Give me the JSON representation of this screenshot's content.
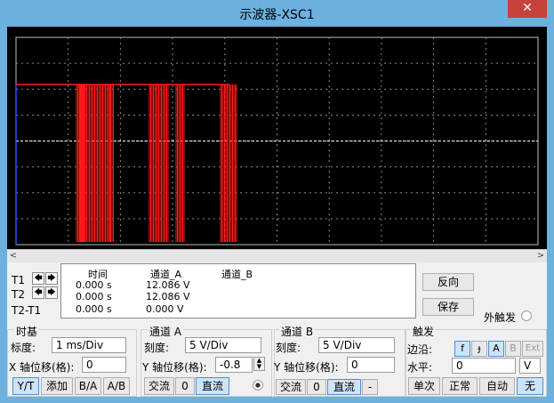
{
  "window": {
    "title": "示波器-XSC1",
    "close_symbol": "✕"
  },
  "screen": {
    "background": "#000000",
    "trace_color": "#ff1a1a",
    "channel_b_color": "#ffffff",
    "grid_color": "#8a8a8a"
  },
  "chart_data": {
    "type": "line",
    "title": "",
    "xlabel": "",
    "ylabel": "",
    "grid": true,
    "divisions_x": 10,
    "divisions_y": 8,
    "series": [
      {
        "name": "通道_A",
        "color": "#ff1a1a",
        "description_values": [
          12.086,
          0.0
        ]
      },
      {
        "name": "通道_B",
        "color": "#ffffff",
        "description_values": [
          0.0
        ]
      }
    ]
  },
  "cursors": {
    "t1": "T1",
    "t2": "T2",
    "diff": "T2-T1",
    "left_arrow": "🡄",
    "right_arrow": "🡆"
  },
  "readout": {
    "headers": {
      "time": "时间",
      "ch_a": "通道_A",
      "ch_b": "通道_B"
    },
    "rows": [
      {
        "time": "0.000 s",
        "ch_a": "12.086 V",
        "ch_b": ""
      },
      {
        "time": "0.000 s",
        "ch_a": "12.086 V",
        "ch_b": ""
      },
      {
        "time": "0.000 s",
        "ch_a": "0.000 V",
        "ch_b": ""
      }
    ]
  },
  "side_buttons": {
    "reverse": "反向",
    "save": "保存",
    "ext_trigger": "外触发"
  },
  "timebase": {
    "title": "时基",
    "scale_label": "标度:",
    "scale_value": "1 ms/Div",
    "xpos_label": "X 轴位移(格):",
    "xpos_value": "0",
    "modes": [
      "Y/T",
      "添加",
      "B/A",
      "A/B"
    ]
  },
  "channel_a": {
    "title": "通道 A",
    "scale_label": "刻度:",
    "scale_value": "5  V/Div",
    "ypos_label": "Y 轴位移(格):",
    "ypos_value": "-0.8",
    "coupling": [
      "交流",
      "0",
      "直流"
    ]
  },
  "channel_b": {
    "title": "通道 B",
    "scale_label": "刻度:",
    "scale_value": "5  V/Div",
    "ypos_label": "Y 轴位移(格):",
    "ypos_value": "0",
    "coupling": [
      "交流",
      "0",
      "直流",
      "-"
    ]
  },
  "trigger": {
    "title": "触发",
    "edge_label": "边沿:",
    "edge_buttons": [
      "f",
      "ɟ",
      "A",
      "B",
      "Ext"
    ],
    "level_label": "水平:",
    "level_value": "0",
    "level_unit": "V",
    "modes": [
      "单次",
      "正常",
      "自动",
      "无"
    ]
  },
  "scrollbar": {
    "left": "<",
    "right": ">"
  }
}
